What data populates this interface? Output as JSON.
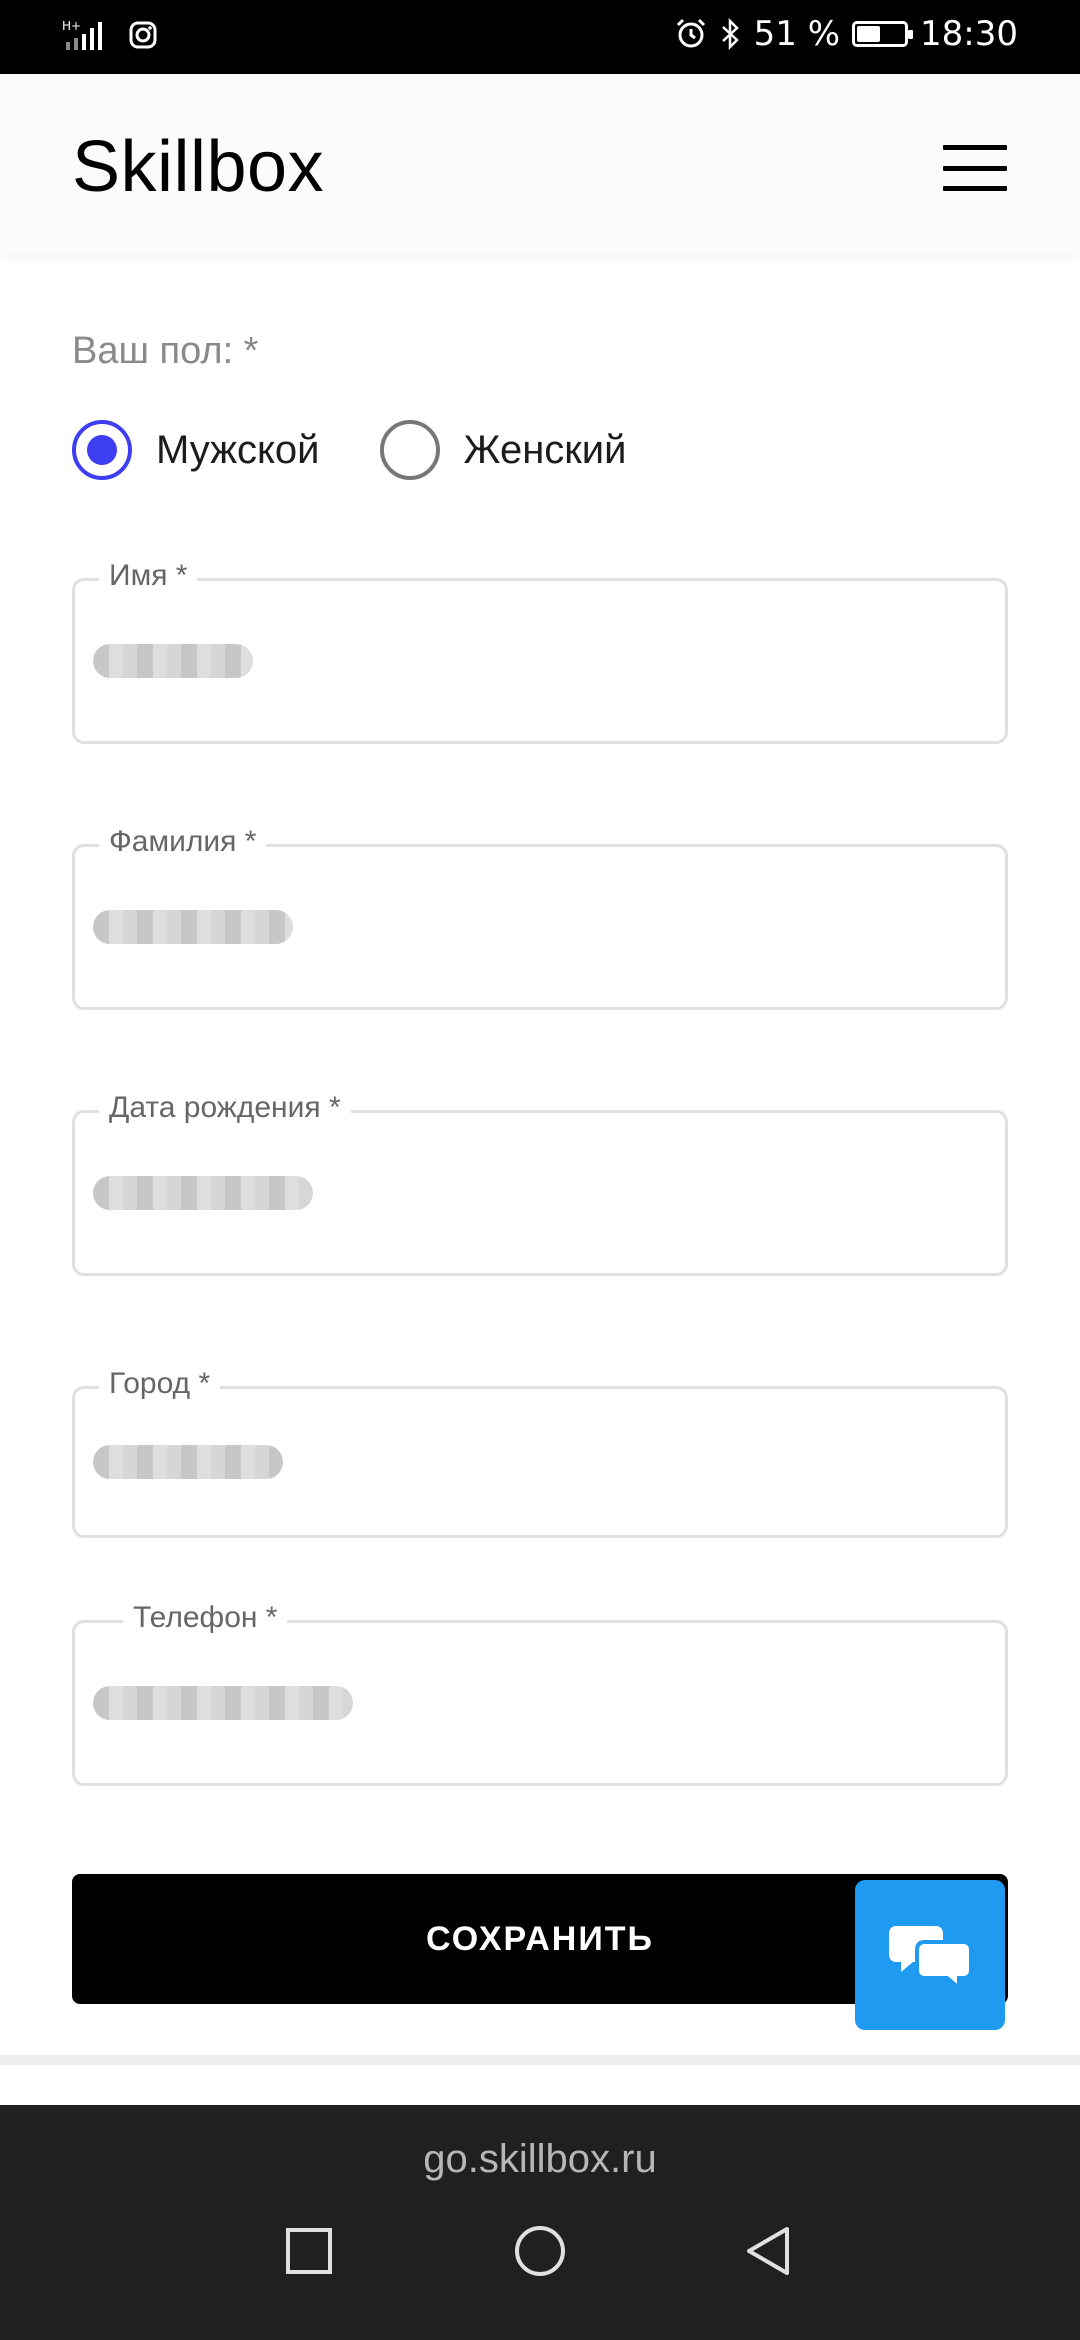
{
  "status_bar": {
    "battery_percent_text": "51 %",
    "battery_level": 0.51,
    "time": "18:30",
    "icons": [
      "signal-icon",
      "instagram-icon",
      "alarm-icon",
      "bluetooth-icon",
      "battery-icon"
    ]
  },
  "header": {
    "logo": "Skillbox",
    "menu_icon": "hamburger-menu-icon"
  },
  "form": {
    "gender_label": "Ваш пол: *",
    "gender_options": [
      {
        "label": "Мужской",
        "checked": true
      },
      {
        "label": "Женский",
        "checked": false
      }
    ],
    "fields": {
      "first_name": {
        "label": "Имя *",
        "value": ""
      },
      "last_name": {
        "label": "Фамилия *",
        "value": ""
      },
      "birth_date": {
        "label": "Дата рождения *",
        "value": ""
      },
      "city": {
        "label": "Город *",
        "value": ""
      },
      "phone": {
        "label": "Телефон *",
        "value": ""
      }
    },
    "save_label": "СОХРАНИТЬ"
  },
  "chat_icon": "chat-bubbles-icon",
  "browser": {
    "url": "go.skillbox.ru"
  },
  "navbar": {
    "icons": [
      "recent-apps-icon",
      "home-icon",
      "back-icon"
    ]
  },
  "colors": {
    "accent": "#3d3df2",
    "chat_button": "#1e9bf0",
    "save_button": "#000000"
  }
}
